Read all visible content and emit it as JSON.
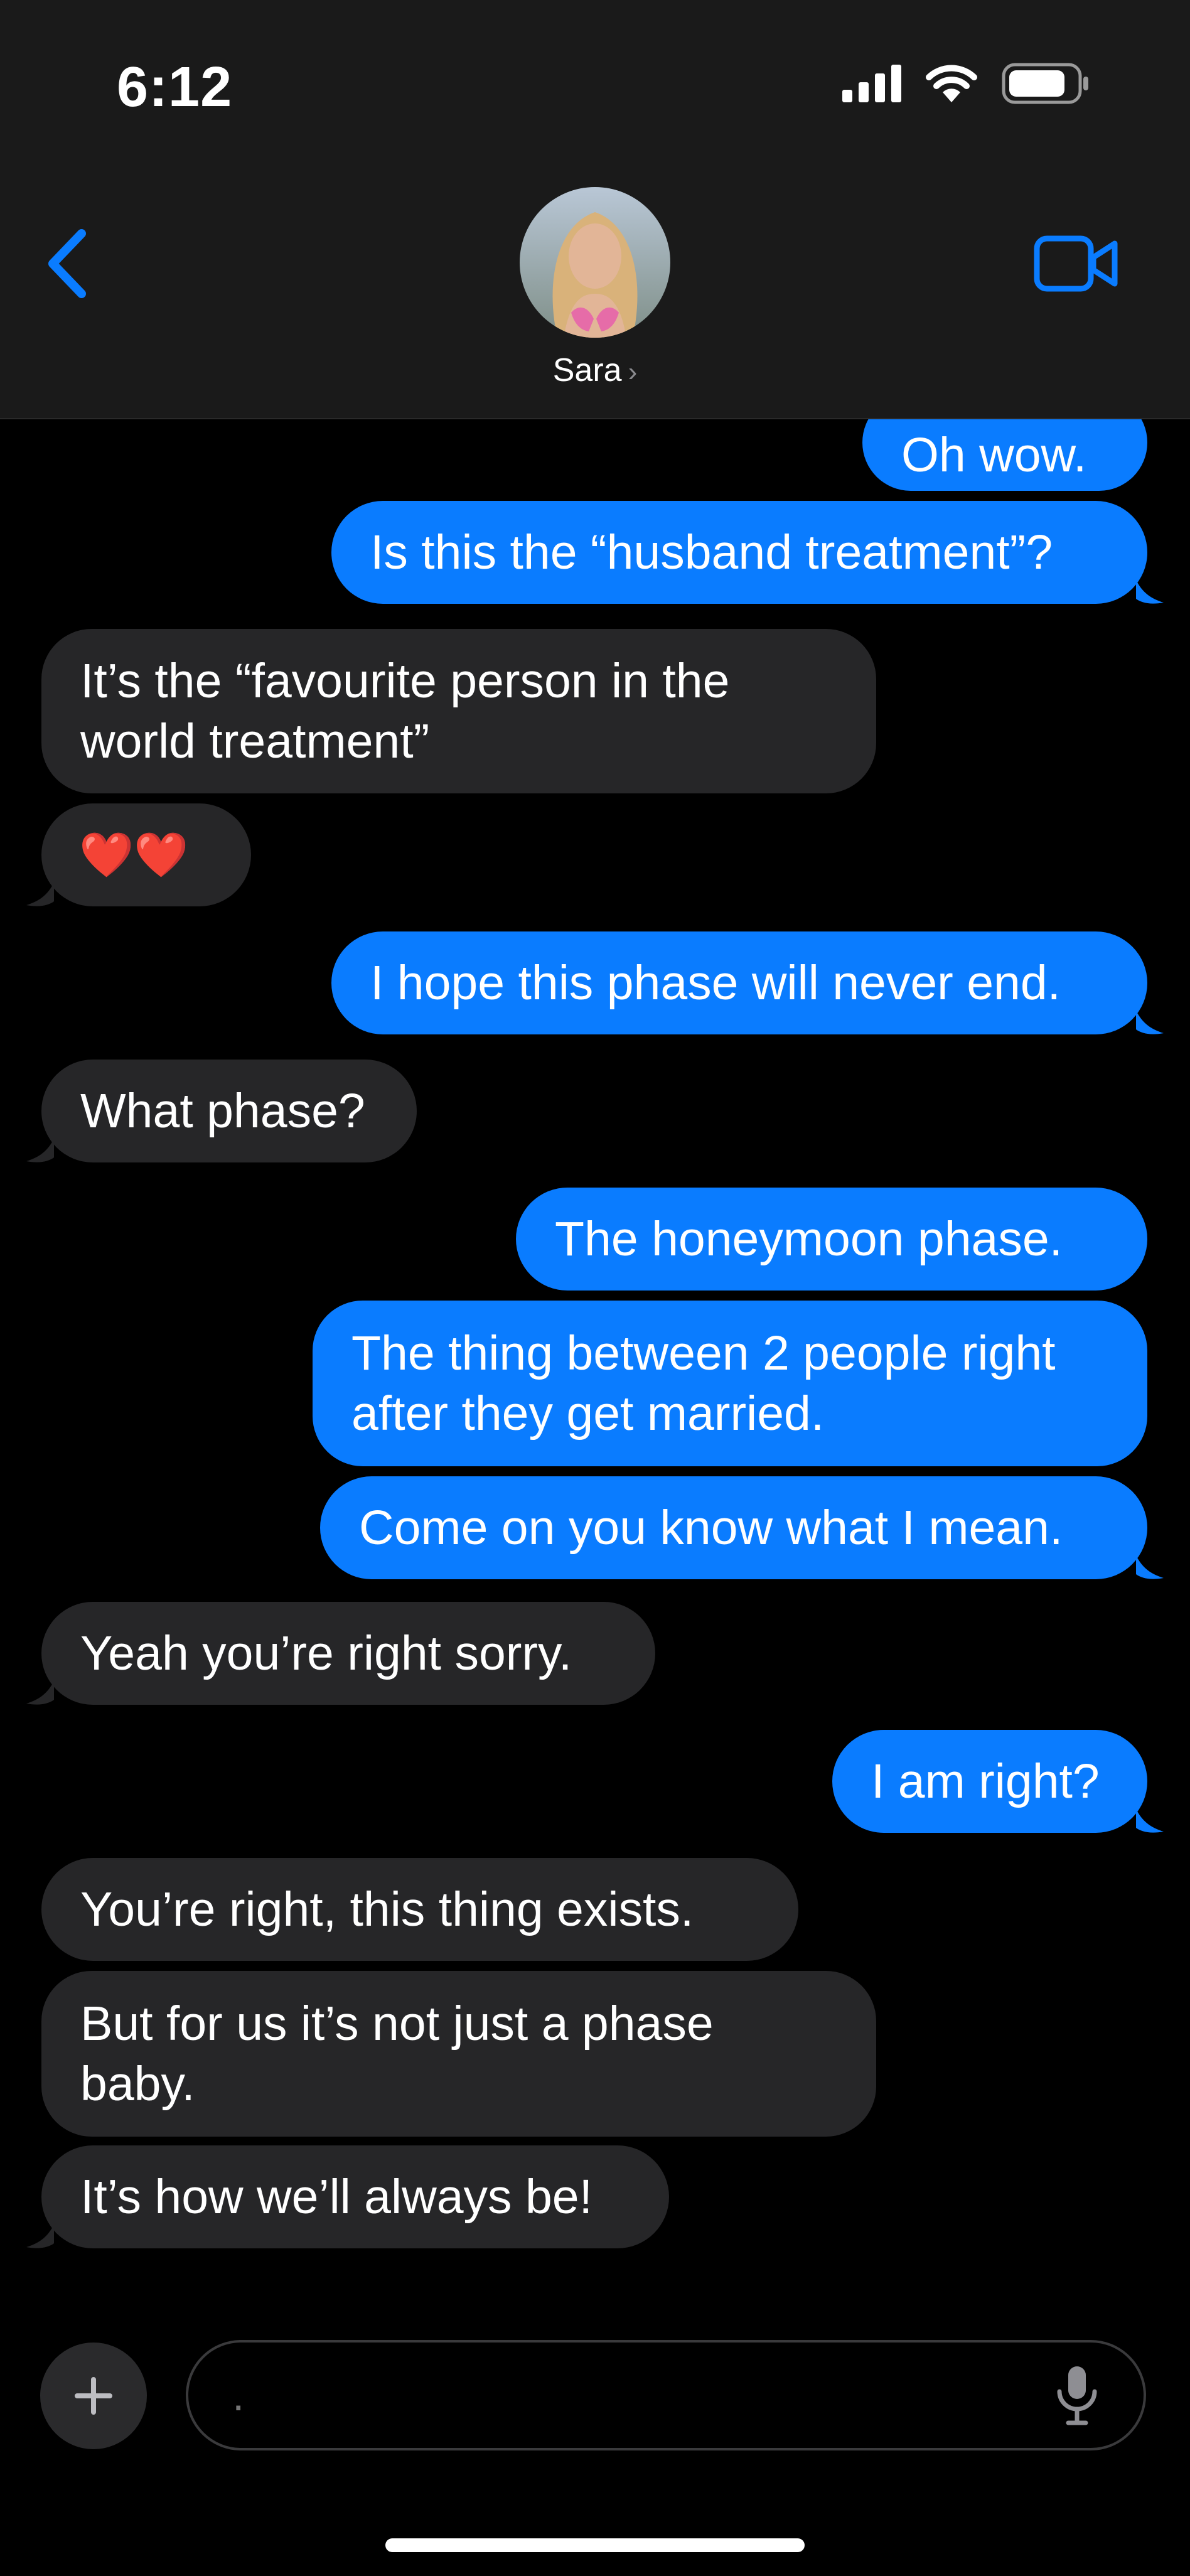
{
  "status_bar": {
    "time": "6:12"
  },
  "header": {
    "contact_name": "Sara",
    "icons": {
      "back": "chevron-left-icon",
      "video": "video-camera-icon"
    },
    "accent_color": "#0a7cff"
  },
  "messages": [
    {
      "id": "m1",
      "from": "me",
      "text": "Oh wow."
    },
    {
      "id": "m2",
      "from": "me",
      "text": "Is this the “husband treatment”?"
    },
    {
      "id": "m3",
      "from": "them",
      "text": "It’s the “favourite person in the world treatment”"
    },
    {
      "id": "m4",
      "from": "them",
      "text": "❤️❤️"
    },
    {
      "id": "m5",
      "from": "me",
      "text": "I hope this phase will never end."
    },
    {
      "id": "m6",
      "from": "them",
      "text": "What phase?"
    },
    {
      "id": "m7",
      "from": "me",
      "text": "The honeymoon phase."
    },
    {
      "id": "m8",
      "from": "me",
      "text": "The thing between 2 people right after they get married."
    },
    {
      "id": "m9",
      "from": "me",
      "text": "Come on you know what I mean."
    },
    {
      "id": "m10",
      "from": "them",
      "text": "Yeah you’re right sorry."
    },
    {
      "id": "m11",
      "from": "me",
      "text": "I am right?"
    },
    {
      "id": "m12",
      "from": "them",
      "text": "You’re right, this thing exists."
    },
    {
      "id": "m13",
      "from": "them",
      "text": "But for us it’s not just a phase baby."
    },
    {
      "id": "m14",
      "from": "them",
      "text": "It’s how we’ll always be!"
    }
  ],
  "composer": {
    "placeholder": ".",
    "icons": {
      "add": "plus-icon",
      "mic": "microphone-icon"
    }
  },
  "colors": {
    "sent_bubble": "#0a7cff",
    "received_bubble": "#262628",
    "background": "#000000"
  }
}
